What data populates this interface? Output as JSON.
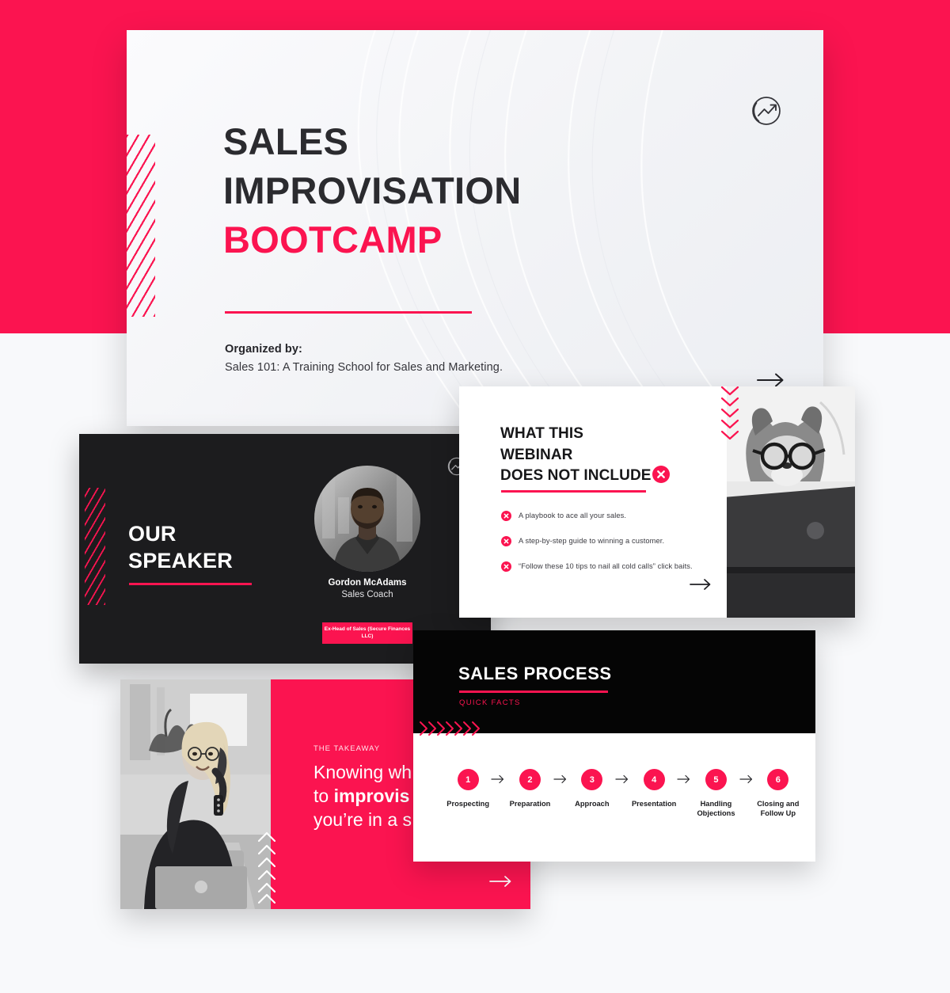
{
  "theme": {
    "accent_red": "#FB1450",
    "dark": "#1C1C1E",
    "black": "#050505",
    "page_bg": "#F8F9FB",
    "slide_light": "#F4F5F8"
  },
  "title_slide": {
    "name": "sales-improvisation-bootcamp-title",
    "heading_line1": "SALES",
    "heading_line2": "IMPROVISATION",
    "heading_line3": "BOOTCAMP",
    "organized_by_label": "Organized by:",
    "organized_by_value": "Sales 101: A Training School for Sales and Marketing.",
    "logo_icon": "trending-up-circle-icon",
    "next_icon": "arrow-right-icon"
  },
  "speaker_slide": {
    "name": "our-speaker",
    "heading_line1": "OUR",
    "heading_line2": "SPEAKER",
    "speaker_name": "Gordon McAdams",
    "speaker_role": "Sales Coach",
    "speaker_badge": "Ex-Head of Sales (Secure Finances LLC)",
    "logo_icon": "trending-up-circle-icon",
    "avatar_icon": "speaker-portrait"
  },
  "webinar_slide": {
    "name": "what-this-webinar-does-not-include",
    "heading_line1": "WHAT THIS",
    "heading_line2": "WEBINAR",
    "heading_line3": "DOES NOT INCLUDE",
    "heading_badge_icon": "x-circle-icon",
    "items": [
      "A playbook to ace all your sales.",
      "A step-by-step guide to winning a customer.",
      "“Follow these 10 tips to nail all cold calls” click baits."
    ],
    "bullet_icon": "x-circle-icon",
    "next_icon": "arrow-right-icon",
    "photo_icon": "dog-with-glasses-at-laptop-photo",
    "chevron_icon": "chevron-down-decor-icon"
  },
  "takeaway_slide": {
    "name": "the-takeaway",
    "kicker": "THE TAKEAWAY",
    "quote_part1": "Knowing wh",
    "quote_bold": "improvis",
    "quote_prefix2": "to ",
    "quote_part3": "you’re in a s",
    "next_icon": "arrow-right-icon",
    "photo_icon": "woman-on-phone-with-laptop-photo",
    "chevron_icon": "chevron-up-decor-icon"
  },
  "process_slide": {
    "name": "sales-process",
    "title": "SALES PROCESS",
    "kicker": "QUICK FACTS",
    "chevron_icon": "chevron-right-decor-icon",
    "arrow_icon": "arrow-right-icon",
    "steps": [
      {
        "number": "1",
        "label": "Prospecting"
      },
      {
        "number": "2",
        "label": "Preparation"
      },
      {
        "number": "3",
        "label": "Approach"
      },
      {
        "number": "4",
        "label": "Presentation"
      },
      {
        "number": "5",
        "label": "Handling Objections"
      },
      {
        "number": "6",
        "label": "Closing and Follow Up"
      }
    ]
  }
}
